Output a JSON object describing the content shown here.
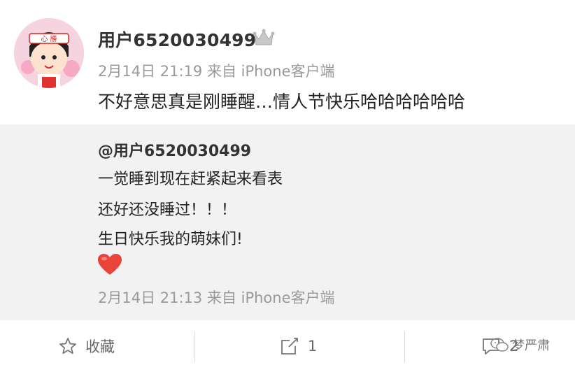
{
  "post": {
    "username": "用户6520030499",
    "meta": "2月14日 21:19 来自 iPhone客户端",
    "text": "不好意思真是刚睡醒…情人节快乐哈哈哈哈哈哈"
  },
  "repost": {
    "author": "@用户6520030499",
    "lines": [
      "一觉睡到现在赶紧起来看表",
      "还好还没睡过！！！",
      "生日快乐我的萌妹们!"
    ],
    "meta": "2月14日 21:13 来自 iPhone客户端"
  },
  "actions": {
    "favorite_label": "收藏",
    "share_count": "1",
    "comment_count": "2"
  },
  "watermark": {
    "text": "梦严肃"
  },
  "icons": [
    "crown-icon",
    "heart-icon",
    "star-icon",
    "share-icon",
    "comment-icon",
    "wechat-icon"
  ],
  "colors": {
    "heart": "#e8443a",
    "meta": "#9a9a9a",
    "repost_bg": "#f2f2f2"
  }
}
